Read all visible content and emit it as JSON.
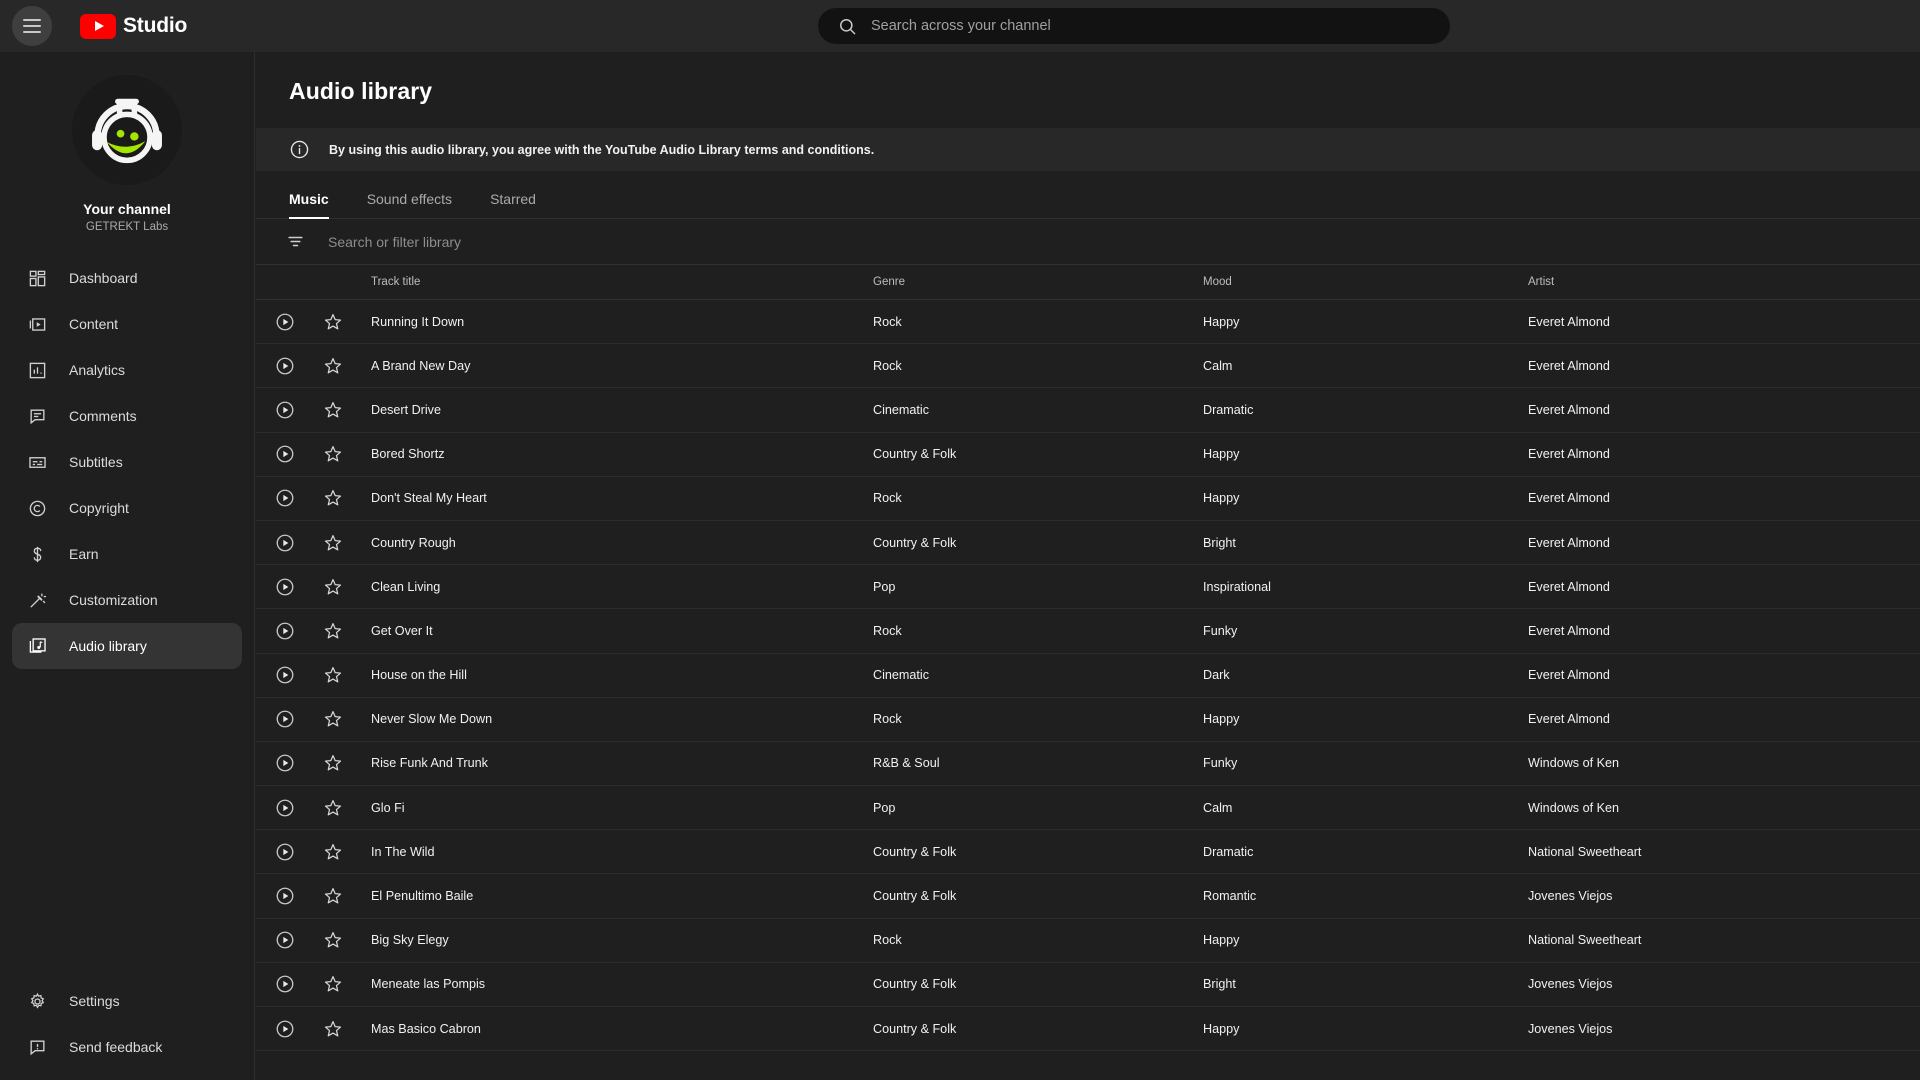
{
  "topbar": {
    "menu_icon": "hamburger-icon",
    "logo_icon": "youtube-logo-icon",
    "brand": "Studio",
    "search": {
      "icon": "search-icon",
      "placeholder": "Search across your channel",
      "value": ""
    }
  },
  "sidebar": {
    "avatar_icon": "channel-avatar-flask-icon",
    "channel_label": "Your channel",
    "channel_name": "GETREKT Labs",
    "items": [
      {
        "label": "Dashboard",
        "icon": "dashboard-icon",
        "active": false
      },
      {
        "label": "Content",
        "icon": "content-icon",
        "active": false
      },
      {
        "label": "Analytics",
        "icon": "analytics-icon",
        "active": false
      },
      {
        "label": "Comments",
        "icon": "comments-icon",
        "active": false
      },
      {
        "label": "Subtitles",
        "icon": "subtitles-icon",
        "active": false
      },
      {
        "label": "Copyright",
        "icon": "copyright-icon",
        "active": false
      },
      {
        "label": "Earn",
        "icon": "earn-dollar-icon",
        "active": false
      },
      {
        "label": "Customization",
        "icon": "customization-wand-icon",
        "active": false
      },
      {
        "label": "Audio library",
        "icon": "audio-library-icon",
        "active": true
      }
    ],
    "bottom_items": [
      {
        "label": "Settings",
        "icon": "gear-icon"
      },
      {
        "label": "Send feedback",
        "icon": "feedback-icon"
      }
    ]
  },
  "main": {
    "page_title": "Audio library",
    "info_banner": {
      "icon": "info-icon",
      "text": "By using this audio library, you agree with the YouTube Audio Library terms and conditions."
    },
    "tabs": [
      {
        "label": "Music",
        "active": true
      },
      {
        "label": "Sound effects",
        "active": false
      },
      {
        "label": "Starred",
        "active": false
      }
    ],
    "filter": {
      "icon": "filter-icon",
      "placeholder": "Search or filter library",
      "value": ""
    },
    "table": {
      "columns": [
        "Track title",
        "Genre",
        "Mood",
        "Artist"
      ],
      "row_icons": {
        "play": "play-circle-icon",
        "star": "star-outline-icon"
      },
      "rows": [
        {
          "title": "Running It Down",
          "genre": "Rock",
          "mood": "Happy",
          "artist": "Everet Almond"
        },
        {
          "title": "A Brand New Day",
          "genre": "Rock",
          "mood": "Calm",
          "artist": "Everet Almond"
        },
        {
          "title": "Desert Drive",
          "genre": "Cinematic",
          "mood": "Dramatic",
          "artist": "Everet Almond"
        },
        {
          "title": "Bored Shortz",
          "genre": "Country & Folk",
          "mood": "Happy",
          "artist": "Everet Almond"
        },
        {
          "title": "Don't Steal My Heart",
          "genre": "Rock",
          "mood": "Happy",
          "artist": "Everet Almond"
        },
        {
          "title": "Country Rough",
          "genre": "Country & Folk",
          "mood": "Bright",
          "artist": "Everet Almond"
        },
        {
          "title": "Clean Living",
          "genre": "Pop",
          "mood": "Inspirational",
          "artist": "Everet Almond"
        },
        {
          "title": "Get Over It",
          "genre": "Rock",
          "mood": "Funky",
          "artist": "Everet Almond"
        },
        {
          "title": "House on the Hill",
          "genre": "Cinematic",
          "mood": "Dark",
          "artist": "Everet Almond"
        },
        {
          "title": "Never Slow Me Down",
          "genre": "Rock",
          "mood": "Happy",
          "artist": "Everet Almond"
        },
        {
          "title": "Rise Funk And Trunk",
          "genre": "R&B & Soul",
          "mood": "Funky",
          "artist": "Windows of Ken"
        },
        {
          "title": "Glo Fi",
          "genre": "Pop",
          "mood": "Calm",
          "artist": "Windows of Ken"
        },
        {
          "title": "In The Wild",
          "genre": "Country & Folk",
          "mood": "Dramatic",
          "artist": "National Sweetheart"
        },
        {
          "title": "El Penultimo Baile",
          "genre": "Country & Folk",
          "mood": "Romantic",
          "artist": "Jovenes Viejos"
        },
        {
          "title": "Big Sky Elegy",
          "genre": "Rock",
          "mood": "Happy",
          "artist": "National Sweetheart"
        },
        {
          "title": "Meneate las Pompis",
          "genre": "Country & Folk",
          "mood": "Bright",
          "artist": "Jovenes Viejos"
        },
        {
          "title": "Mas Basico Cabron",
          "genre": "Country & Folk",
          "mood": "Happy",
          "artist": "Jovenes Viejos"
        }
      ]
    }
  },
  "colors": {
    "brand_red": "#ff0000",
    "app_bg": "#1f1f1f",
    "header_bg": "#282828",
    "accent_green": "#a4e600"
  }
}
